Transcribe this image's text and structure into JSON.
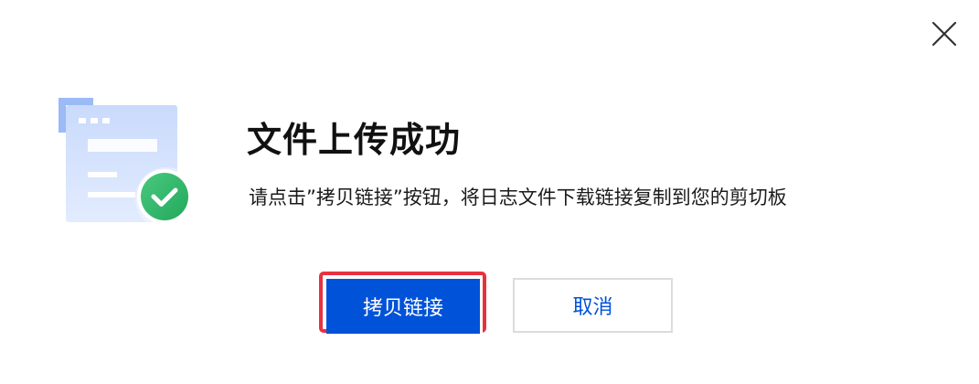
{
  "dialog": {
    "title": "文件上传成功",
    "message": "请点击”拷贝链接”按钮，将日志文件下载链接复制到您的剪切板",
    "primary_button_label": "拷贝链接",
    "secondary_button_label": "取消",
    "illustration_icon": "document-success-icon",
    "close_icon": "close-icon"
  },
  "colors": {
    "primary": "#0052d9",
    "highlight_border": "#e8313f",
    "success": "#2fb36a",
    "illustration_light": "#c5d8fb",
    "illustration_accent": "#8fb1f3"
  }
}
